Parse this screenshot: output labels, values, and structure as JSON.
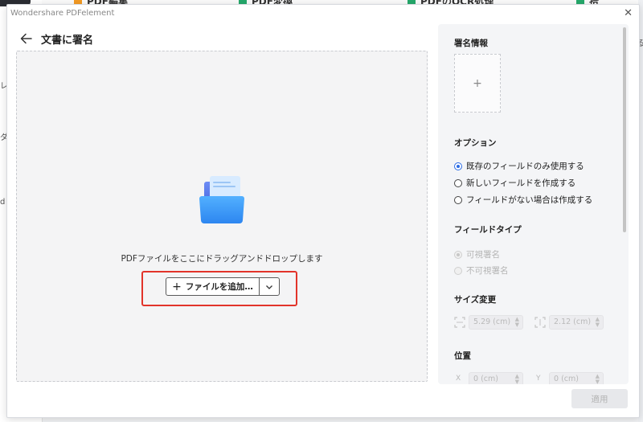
{
  "app": {
    "title": "Wondershare PDFelement"
  },
  "background_tools": [
    "PDF編集",
    "PDF変換",
    "PDFのOCR処理",
    "拾"
  ],
  "background_left": [
    "レ",
    "ダ",
    "d"
  ],
  "background_right": [
    "る"
  ],
  "header": {
    "title": "文書に署名"
  },
  "drop": {
    "instruction": "PDFファイルをここにドラッグアンドドロップします",
    "add_button_label": "ファイルを追加…"
  },
  "panel": {
    "signature_title": "署名情報",
    "signature_add": "+",
    "options_title": "オプション",
    "options": [
      {
        "label": "既存のフィールドのみ使用する",
        "selected": true
      },
      {
        "label": "新しいフィールドを作成する",
        "selected": false
      },
      {
        "label": "フィールドがない場合は作成する",
        "selected": false
      }
    ],
    "field_type_title": "フィールドタイプ",
    "field_types": [
      {
        "label": "可視署名",
        "selected": true
      },
      {
        "label": "不可視署名",
        "selected": false
      }
    ],
    "resize_title": "サイズ変更",
    "width_value": "5.29 (cm)",
    "height_value": "2.12 (cm)",
    "position_title": "位置",
    "x_label": "X",
    "y_label": "Y",
    "x_value": "0 (cm)",
    "y_value": "0 (cm)"
  },
  "apply_label": "適用",
  "colors": {
    "accent": "#2b6be4",
    "highlight": "#e2342a"
  }
}
